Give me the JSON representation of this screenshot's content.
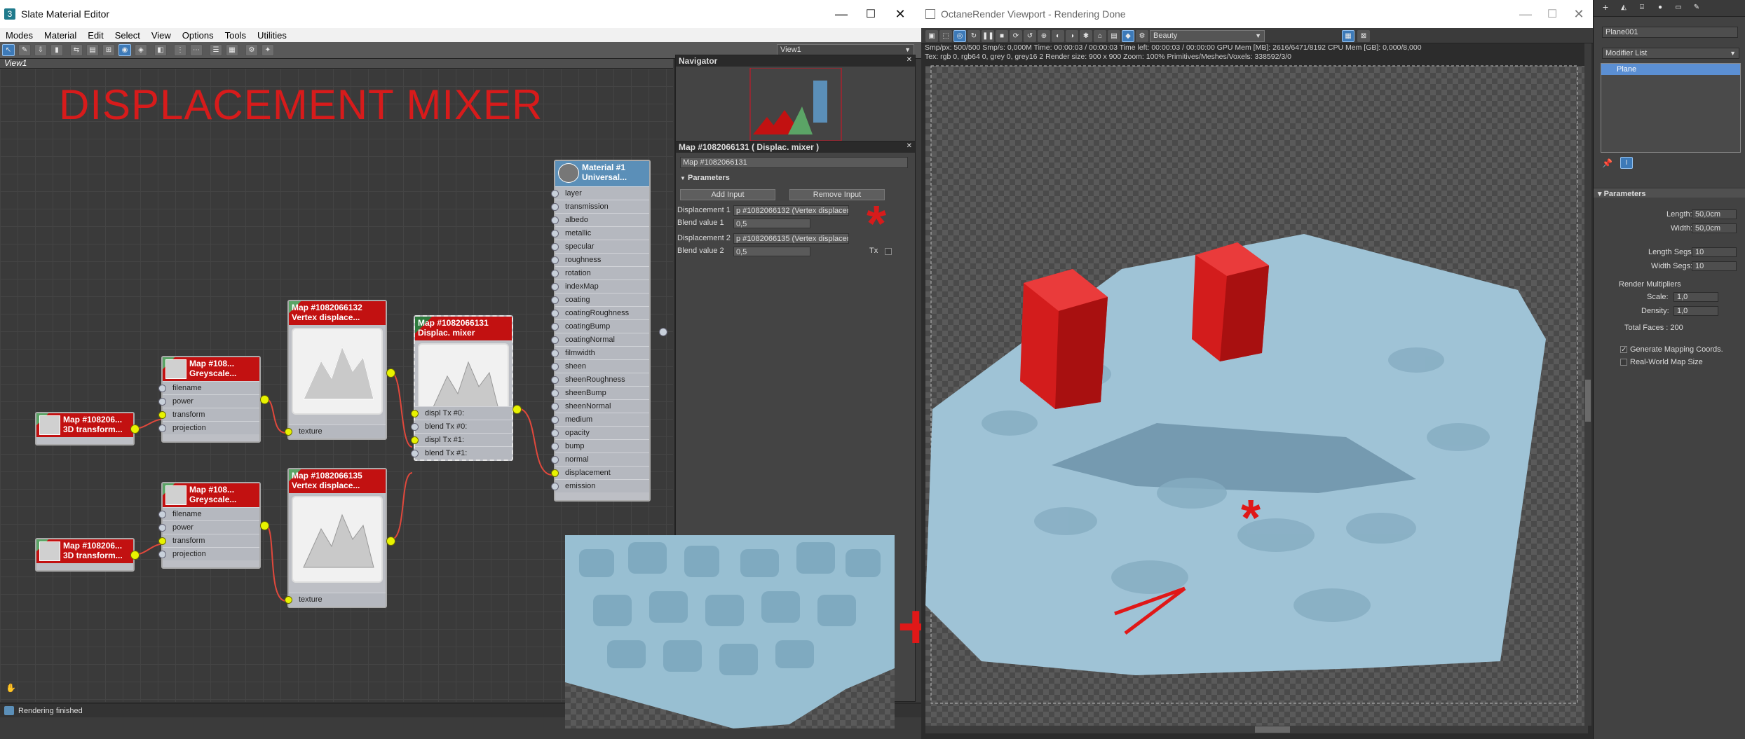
{
  "slate": {
    "title": "Slate Material Editor",
    "menu": [
      "Modes",
      "Material",
      "Edit",
      "Select",
      "View",
      "Options",
      "Tools",
      "Utilities"
    ],
    "view_select": "View1",
    "view_tab": "View1",
    "big_title": "DISPLACEMENT MIXER",
    "status": "Rendering finished",
    "window_controls": {
      "minimize": "—",
      "maximize": "☐",
      "close": "✕"
    },
    "nodes": {
      "transform1": {
        "line1": "Map #108206...",
        "line2": "3D transform..."
      },
      "transform2": {
        "line1": "Map #108206...",
        "line2": "3D transform..."
      },
      "grey1": {
        "line1": "Map #108...",
        "line2": "Greyscale...",
        "slots": [
          "filename",
          "power",
          "transform",
          "projection"
        ]
      },
      "grey2": {
        "line1": "Map #108...",
        "line2": "Greyscale...",
        "slots": [
          "filename",
          "power",
          "transform",
          "projection"
        ]
      },
      "vertex1": {
        "line1": "Map #1082066132",
        "line2": "Vertex displace...",
        "slot": "texture"
      },
      "vertex2": {
        "line1": "Map #1082066135",
        "line2": "Vertex displace...",
        "slot": "texture"
      },
      "mixer": {
        "line1": "Map #1082066131",
        "line2": "Displac. mixer",
        "slots": [
          "displ Tx #0:",
          "blend Tx #0:",
          "displ Tx #1:",
          "blend Tx #1:"
        ]
      },
      "material": {
        "line1": "Material #1",
        "line2": "Universal...",
        "slots": [
          "layer",
          "transmission",
          "albedo",
          "metallic",
          "specular",
          "roughness",
          "rotation",
          "indexMap",
          "coating",
          "coatingRoughness",
          "coatingBump",
          "coatingNormal",
          "filmwidth",
          "sheen",
          "sheenRoughness",
          "sheenBump",
          "sheenNormal",
          "medium",
          "opacity",
          "bump",
          "normal",
          "displacement",
          "emission"
        ]
      }
    },
    "navigator": {
      "title": "Navigator"
    },
    "params": {
      "title": "Map #1082066131  ( Displac. mixer )",
      "name_field": "Map #1082066131",
      "rollout": "Parameters",
      "add_input": "Add Input",
      "remove_input": "Remove Input",
      "rows": [
        {
          "label": "Displacement 1",
          "map": "p #1082066132 (Vertex displaceme",
          "blend_label": "Blend value 1",
          "blend": "0,5"
        },
        {
          "label": "Displacement 2",
          "map": "p #1082066135 (Vertex displaceme",
          "blend_label": "Blend value 2",
          "blend": "0,5"
        }
      ],
      "tx_label": "Tx"
    }
  },
  "octane": {
    "title": "OctaneRender Viewport - Rendering Done",
    "beauty": "Beauty",
    "info_line1": "Smp/px: 500/500    Smp/s: 0,000M    Time: 00:00:03 / 00:00:03    Time left: 00:00:03 / 00:00:00    GPU Mem [MB]: 2616/6471/8192    CPU Mem [GB]: 0,000/8,000",
    "info_line2": "Tex: rgb 0, rgb64 0, grey 0, grey16 2    Render size: 900 x 900    Zoom: 100%    Primitives/Meshes/Voxels: 338592/3/0"
  },
  "cmd": {
    "object_name": "Plane001",
    "modifier_list": "Modifier List",
    "stack_item": "Plane",
    "rollout": "Parameters",
    "length_label": "Length:",
    "length": "50,0cm",
    "width_label": "Width:",
    "width": "50,0cm",
    "lsegs_label": "Length Segs:",
    "lsegs": "10",
    "wsegs_label": "Width Segs:",
    "wsegs": "10",
    "render_mult": "Render Multipliers",
    "scale_label": "Scale:",
    "scale": "1,0",
    "density_label": "Density:",
    "density": "1,0",
    "faces": "Total Faces : 200",
    "gen_map": "Generate Mapping Coords.",
    "real_world": "Real-World Map Size"
  },
  "colors": {
    "accent_red": "#d71b1b",
    "node_green": "#5ba466",
    "node_red": "#c21111",
    "wire": "#e0483c",
    "socket": "#e8f300",
    "displacement_blue": "#a8c8d8"
  }
}
